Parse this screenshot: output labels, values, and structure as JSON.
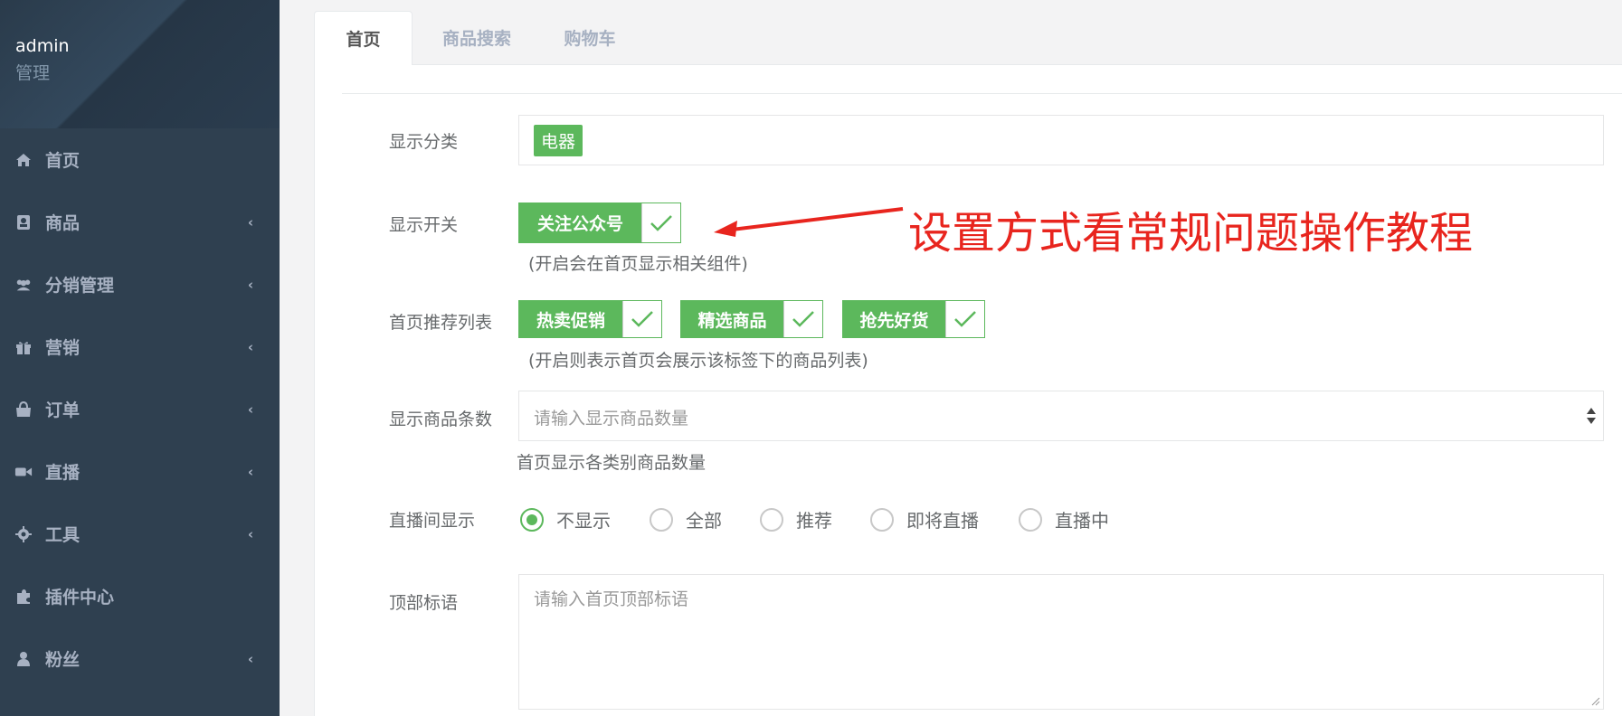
{
  "sidebar": {
    "user_name": "admin",
    "user_role": "管理",
    "items": [
      {
        "label": "首页",
        "icon": "home-icon",
        "has_children": false
      },
      {
        "label": "商品",
        "icon": "product-icon",
        "has_children": true
      },
      {
        "label": "分销管理",
        "icon": "users-icon",
        "has_children": true
      },
      {
        "label": "营销",
        "icon": "gift-icon",
        "has_children": true
      },
      {
        "label": "订单",
        "icon": "shopping-bag-icon",
        "has_children": true
      },
      {
        "label": "直播",
        "icon": "video-camera-icon",
        "has_children": true
      },
      {
        "label": "工具",
        "icon": "gear-icon",
        "has_children": true
      },
      {
        "label": "插件中心",
        "icon": "puzzle-icon",
        "has_children": false
      },
      {
        "label": "粉丝",
        "icon": "user-icon",
        "has_children": true
      }
    ]
  },
  "tabs": [
    {
      "label": "首页",
      "active": true
    },
    {
      "label": "商品搜索",
      "active": false
    },
    {
      "label": "购物车",
      "active": false
    }
  ],
  "form": {
    "category": {
      "label": "显示分类",
      "tags": [
        "电器"
      ]
    },
    "switch": {
      "label": "显示开关",
      "options": [
        "关注公众号"
      ],
      "help": "(开启会在首页显示相关组件)"
    },
    "recommend": {
      "label": "首页推荐列表",
      "options": [
        "热卖促销",
        "精选商品",
        "抢先好货"
      ],
      "help": "(开启则表示首页会展示该标签下的商品列表)"
    },
    "count": {
      "label": "显示商品条数",
      "placeholder": "请输入显示商品数量",
      "help": "首页显示各类别商品数量"
    },
    "live": {
      "label": "直播间显示",
      "options": [
        "不显示",
        "全部",
        "推荐",
        "即将直播",
        "直播中"
      ],
      "selected": "不显示"
    },
    "slogan": {
      "label": "顶部标语",
      "placeholder": "请输入首页顶部标语"
    }
  },
  "annotation": {
    "text": "设置方式看常规问题操作教程",
    "color": "#e8251e"
  },
  "colors": {
    "accent": "#5cb85c",
    "sidebar_bg": "#2f4050"
  }
}
